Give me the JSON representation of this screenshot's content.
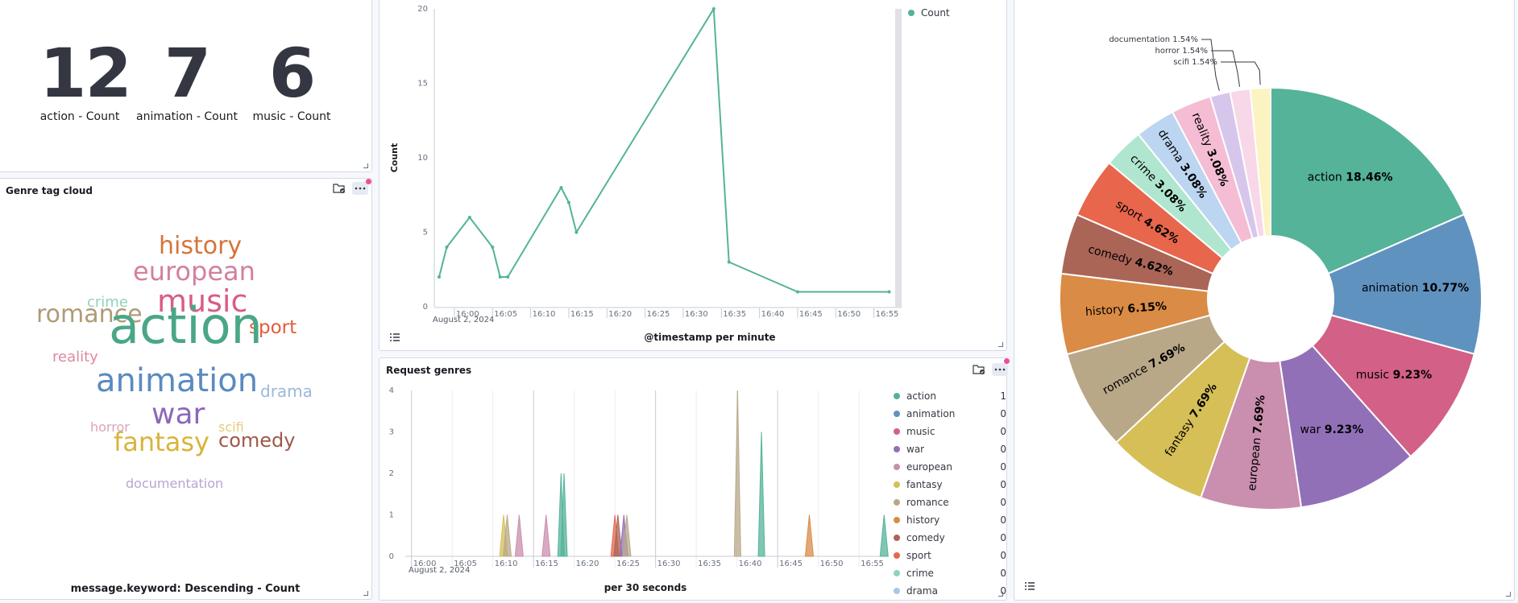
{
  "metrics": [
    {
      "value": "12",
      "label": "action - Count"
    },
    {
      "value": "7",
      "label": "animation - Count"
    },
    {
      "value": "6",
      "label": "music - Count"
    }
  ],
  "tagcloud": {
    "title": "Genre tag cloud",
    "footer": "message.keyword: Descending - Count",
    "words": [
      {
        "text": "history",
        "color": "#d6743a"
      },
      {
        "text": "european",
        "color": "#d280a0"
      },
      {
        "text": "crime",
        "color": "#8fd3b8"
      },
      {
        "text": "music",
        "color": "#d95c89"
      },
      {
        "text": "romance",
        "color": "#b09a76"
      },
      {
        "text": "sport",
        "color": "#e25c3d"
      },
      {
        "text": "reality",
        "color": "#e088a0"
      },
      {
        "text": "action",
        "color": "#4aa785"
      },
      {
        "text": "drama",
        "color": "#9cb8dc"
      },
      {
        "text": "animation",
        "color": "#5a8ac0"
      },
      {
        "text": "horror",
        "color": "#dca3bd"
      },
      {
        "text": "war",
        "color": "#8b67b8"
      },
      {
        "text": "scifi",
        "color": "#e3cc7e"
      },
      {
        "text": "comedy",
        "color": "#a0584a"
      },
      {
        "text": "fantasy",
        "color": "#d8b43a"
      },
      {
        "text": "documentation",
        "color": "#b9a4d3"
      }
    ]
  },
  "line_chart": {
    "legend": "Count",
    "ylabel": "Count",
    "xlabel": "@timestamp per minute",
    "date": "August 2, 2024",
    "color": "#54b399"
  },
  "area_chart": {
    "title": "Request genres",
    "xlabel": "per 30 seconds",
    "date": "August 2, 2024",
    "legend": [
      {
        "name": "action",
        "value": "1",
        "color": "#54b399"
      },
      {
        "name": "animation",
        "value": "0",
        "color": "#6092c0"
      },
      {
        "name": "music",
        "value": "0",
        "color": "#d36086"
      },
      {
        "name": "war",
        "value": "0",
        "color": "#9170b8"
      },
      {
        "name": "european",
        "value": "0",
        "color": "#ca8eae"
      },
      {
        "name": "fantasy",
        "value": "0",
        "color": "#d6bf57"
      },
      {
        "name": "romance",
        "value": "0",
        "color": "#b9a888"
      },
      {
        "name": "history",
        "value": "0",
        "color": "#da8b45"
      },
      {
        "name": "comedy",
        "value": "0",
        "color": "#aa6556"
      },
      {
        "name": "sport",
        "value": "0",
        "color": "#e7664c"
      },
      {
        "name": "crime",
        "value": "0",
        "color": "#8fd3b8"
      },
      {
        "name": "drama",
        "value": "0",
        "color": "#a8c6ea"
      }
    ]
  },
  "chart_data": [
    {
      "type": "line",
      "ylabel": "Count",
      "xlabel": "@timestamp per minute",
      "x": [
        "15:58",
        "15:59",
        "16:02",
        "16:05",
        "16:06",
        "16:07",
        "16:14",
        "16:15",
        "16:16",
        "16:34",
        "16:36",
        "16:45",
        "16:57"
      ],
      "series": [
        {
          "name": "Count",
          "values": [
            2,
            4,
            6,
            4,
            2,
            2,
            8,
            7,
            5,
            20,
            3,
            1,
            1
          ]
        }
      ],
      "ylim": [
        0,
        20
      ],
      "yticks": [
        "0",
        "5",
        "10",
        "15",
        "20"
      ],
      "xticks": [
        "16:00",
        "16:05",
        "16:10",
        "16:15",
        "16:20",
        "16:25",
        "16:30",
        "16:35",
        "16:40",
        "16:45",
        "16:50",
        "16:55"
      ]
    },
    {
      "type": "area",
      "xlabel": "per 30 seconds",
      "ylim": [
        0,
        4
      ],
      "yticks": [
        "0",
        "1",
        "2",
        "3",
        "4"
      ],
      "xticks": [
        "16:00",
        "16:05",
        "16:10",
        "16:15",
        "16:20",
        "16:25",
        "16:30",
        "16:35",
        "16:40",
        "16:45",
        "16:50",
        "16:55"
      ],
      "spikes": [
        {
          "t": 15.9,
          "v": 1,
          "series": "fantasy"
        },
        {
          "t": 16.5,
          "v": 1,
          "series": "romance"
        },
        {
          "t": 18.5,
          "v": 1,
          "series": "european"
        },
        {
          "t": 23.0,
          "v": 1,
          "series": "european"
        },
        {
          "t": 25.5,
          "v": 2,
          "series": "action"
        },
        {
          "t": 26.0,
          "v": 2,
          "series": "action"
        },
        {
          "t": 34.5,
          "v": 1,
          "series": "sport"
        },
        {
          "t": 35.0,
          "v": 1,
          "series": "comedy"
        },
        {
          "t": 36.0,
          "v": 1,
          "series": "war"
        },
        {
          "t": 36.5,
          "v": 1,
          "series": "romance"
        },
        {
          "t": 55.0,
          "v": 4,
          "series": "romance"
        },
        {
          "t": 59.0,
          "v": 3,
          "series": "action"
        },
        {
          "t": 67.0,
          "v": 1,
          "series": "history"
        },
        {
          "t": 79.5,
          "v": 1,
          "series": "action"
        }
      ]
    },
    {
      "type": "pie",
      "slices": [
        {
          "label": "action",
          "pct": 18.46,
          "text": "18.46%",
          "color": "#54b399"
        },
        {
          "label": "animation",
          "pct": 10.77,
          "text": "10.77%",
          "color": "#6092c0"
        },
        {
          "label": "music",
          "pct": 9.23,
          "text": "9.23%",
          "color": "#d36086"
        },
        {
          "label": "war",
          "pct": 9.23,
          "text": "9.23%",
          "color": "#9170b8"
        },
        {
          "label": "european",
          "pct": 7.69,
          "text": "7.69%",
          "color": "#ca8eae"
        },
        {
          "label": "fantasy",
          "pct": 7.69,
          "text": "7.69%",
          "color": "#d6bf57"
        },
        {
          "label": "romance",
          "pct": 7.69,
          "text": "7.69%",
          "color": "#b9a888"
        },
        {
          "label": "history",
          "pct": 6.15,
          "text": "6.15%",
          "color": "#da8b45"
        },
        {
          "label": "comedy",
          "pct": 4.62,
          "text": "4.62%",
          "color": "#aa6556"
        },
        {
          "label": "sport",
          "pct": 4.62,
          "text": "4.62%",
          "color": "#e7664c"
        },
        {
          "label": "crime",
          "pct": 3.08,
          "text": "3.08%",
          "color": "#b0e6cf"
        },
        {
          "label": "drama",
          "pct": 3.08,
          "text": "3.08%",
          "color": "#bcd5f1"
        },
        {
          "label": "reality",
          "pct": 3.08,
          "text": "3.08%",
          "color": "#f4bdd3"
        },
        {
          "label": "documentation",
          "pct": 1.54,
          "text": "1.54%",
          "color": "#d7c6ec"
        },
        {
          "label": "horror",
          "pct": 1.54,
          "text": "1.54%",
          "color": "#f8d7e9"
        },
        {
          "label": "scifi",
          "pct": 1.54,
          "text": "1.54%",
          "color": "#fbf3c1"
        }
      ]
    }
  ]
}
